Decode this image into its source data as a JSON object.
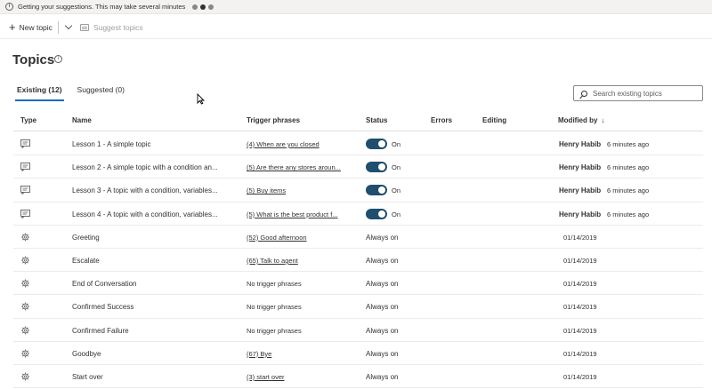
{
  "banner": {
    "text": "Getting your suggestions. This may take several minutes"
  },
  "toolbar": {
    "new_topic_label": "New topic",
    "suggest_topics_label": "Suggest topics"
  },
  "page": {
    "title": "Topics"
  },
  "tabs": [
    {
      "label": "Existing (12)",
      "active": true
    },
    {
      "label": "Suggested (0)",
      "active": false
    }
  ],
  "search": {
    "placeholder": "Search existing topics"
  },
  "columns": {
    "type": "Type",
    "name": "Name",
    "trigger": "Trigger phrases",
    "status": "Status",
    "errors": "Errors",
    "editing": "Editing",
    "modified_by": "Modified by",
    "sort_indicator": "↓"
  },
  "rows": [
    {
      "icon": "chat-icon",
      "name": "Lesson 1 - A simple topic",
      "trigger": "(4) When are you closed",
      "status": "On",
      "modified_by": "Henry Habib",
      "modified": "6 minutes ago"
    },
    {
      "icon": "chat-icon",
      "name": "Lesson 2 - A simple topic with a condition an...",
      "trigger": "(5) Are there any stores aroun...",
      "status": "On",
      "modified_by": "Henry Habib",
      "modified": "6 minutes ago"
    },
    {
      "icon": "chat-icon",
      "name": "Lesson 3 - A topic with a condition, variables...",
      "trigger": "(5) Buy items",
      "status": "On",
      "modified_by": "Henry Habib",
      "modified": "6 minutes ago"
    },
    {
      "icon": "chat-icon",
      "name": "Lesson 4 - A topic with a condition, variables...",
      "trigger": "(5) What is the best product f...",
      "status": "On",
      "modified_by": "Henry Habib",
      "modified": "6 minutes ago"
    },
    {
      "icon": "system-gear-icon",
      "name": "Greeting",
      "trigger": "(52) Good afternoon",
      "status": "Always on",
      "modified_by": "",
      "modified": "01/14/2019"
    },
    {
      "icon": "system-gear-icon",
      "name": "Escalate",
      "trigger": "(65) Talk to agent",
      "status": "Always on",
      "modified_by": "",
      "modified": "01/14/2019"
    },
    {
      "icon": "system-gear-icon",
      "name": "End of Conversation",
      "trigger": "No trigger phrases",
      "status": "Always on",
      "modified_by": "",
      "modified": "01/14/2019"
    },
    {
      "icon": "system-gear-icon",
      "name": "Confirmed Success",
      "trigger": "No trigger phrases",
      "status": "Always on",
      "modified_by": "",
      "modified": "01/14/2019"
    },
    {
      "icon": "system-gear-icon",
      "name": "Confirmed Failure",
      "trigger": "No trigger phrases",
      "status": "Always on",
      "modified_by": "",
      "modified": "01/14/2019"
    },
    {
      "icon": "system-gear-icon",
      "name": "Goodbye",
      "trigger": "(67) Bye",
      "status": "Always on",
      "modified_by": "",
      "modified": "01/14/2019"
    },
    {
      "icon": "system-gear-icon",
      "name": "Start over",
      "trigger": "(3) start over",
      "status": "Always on",
      "modified_by": "",
      "modified": "01/14/2019"
    }
  ]
}
